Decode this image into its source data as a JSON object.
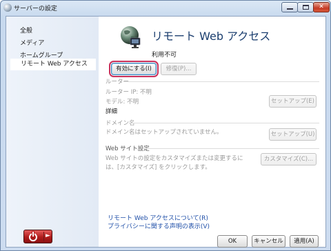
{
  "window": {
    "title": "サーバーの設定"
  },
  "sidebar": {
    "items": [
      {
        "label": "全般"
      },
      {
        "label": "メディア"
      },
      {
        "label": "ホームグループ"
      },
      {
        "label": "リモート Web アクセス",
        "selected": true
      }
    ]
  },
  "main": {
    "heading": "リモート Web アクセス",
    "status": "利用不可",
    "enable_button": "有効にする(I)",
    "repair_button": "修復(P)...",
    "router": {
      "title": "ルーター",
      "ip": "ルーター IP: 不明",
      "model": "モデル: 不明",
      "setup_button": "セットアップ(E)"
    },
    "details_label": "詳細",
    "domain": {
      "title": "ドメイン名",
      "text": "ドメイン名はセットアップされていません。",
      "setup_button": "セットアップ(U)"
    },
    "website": {
      "title": "Web サイト設定",
      "text_line1": "Web サイトの設定をカスタマイズまたは変更するに",
      "text_line2": "は、[カスタマイズ] をクリックします。",
      "customize_button": "カスタマイズ(C)..."
    },
    "links": {
      "about": "リモート Web アクセスについて(R)",
      "privacy": "プライバシーに関する声明の表示(V)"
    }
  },
  "footer": {
    "ok": "OK",
    "cancel": "キャンセル",
    "apply": "適用(A)"
  },
  "icons": {
    "title": "window-icon",
    "globe": "globe-monitor-icon",
    "power": "power-icon"
  }
}
